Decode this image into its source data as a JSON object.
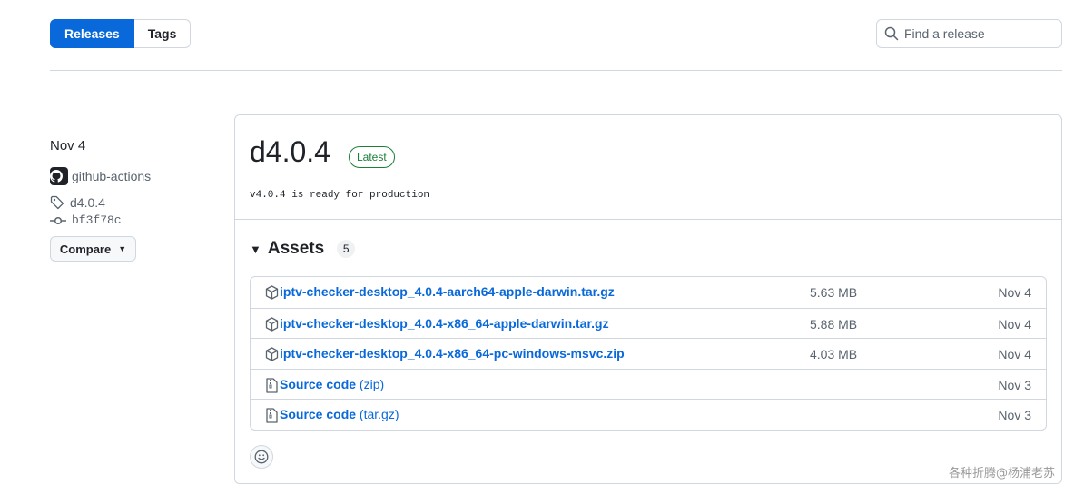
{
  "tabs": {
    "releases_label": "Releases",
    "tags_label": "Tags"
  },
  "search": {
    "placeholder": "Find a release"
  },
  "meta": {
    "date": "Nov 4",
    "author": "github-actions",
    "tag": "d4.0.4",
    "commit": "bf3f78c",
    "compare_label": "Compare"
  },
  "release": {
    "title": "d4.0.4",
    "badge": "Latest",
    "body": "v4.0.4 is ready for production"
  },
  "assets": {
    "title": "Assets",
    "count": "5",
    "items": [
      {
        "name": "iptv-checker-desktop_4.0.4-aarch64-apple-darwin.tar.gz",
        "suffix": "",
        "size": "5.63 MB",
        "date": "Nov 4",
        "icon": "package-icon"
      },
      {
        "name": "iptv-checker-desktop_4.0.4-x86_64-apple-darwin.tar.gz",
        "suffix": "",
        "size": "5.88 MB",
        "date": "Nov 4",
        "icon": "package-icon"
      },
      {
        "name": "iptv-checker-desktop_4.0.4-x86_64-pc-windows-msvc.zip",
        "suffix": "",
        "size": "4.03 MB",
        "date": "Nov 4",
        "icon": "package-icon"
      },
      {
        "name": "Source code",
        "suffix": " (zip)",
        "size": "",
        "date": "Nov 3",
        "icon": "file-zip-icon"
      },
      {
        "name": "Source code",
        "suffix": " (tar.gz)",
        "size": "",
        "date": "Nov 3",
        "icon": "file-zip-icon"
      }
    ]
  },
  "watermark": "各种折腾@杨浦老苏",
  "colors": {
    "accent": "#0969da",
    "latest": "#1a7f37",
    "border": "#d0d7de",
    "muted": "#59636e"
  }
}
